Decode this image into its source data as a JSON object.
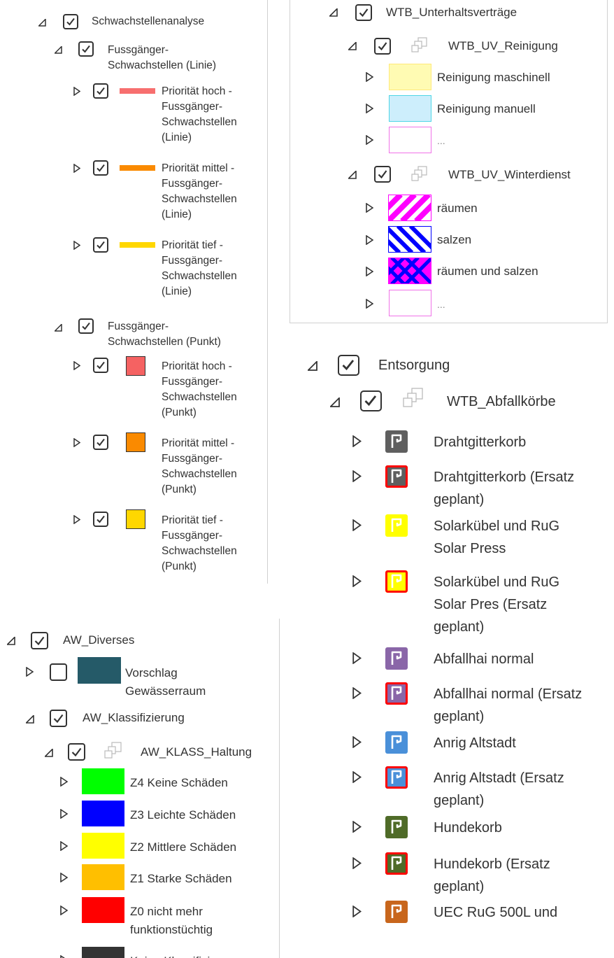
{
  "colors": {
    "text": "#333333",
    "divider": "#d0d0d0",
    "line_hoch": "#f76f6f",
    "line_mittel": "#fa8a00",
    "line_tief": "#ffd700",
    "pt_hoch": "#f56262",
    "pt_mittel": "#fa8a00",
    "pt_tief": "#ffd700",
    "vorschlag": "#255a68",
    "reinigung_maschinell": "#fffbb3",
    "reinigung_manuell": "#cdeefc",
    "z4": "#00ff00",
    "z3": "#0000ff",
    "z2": "#ffff00",
    "z1": "#ffbf00",
    "z0": "#ff0000",
    "keine": "#333333",
    "drahtgitter": "#5f5f5f",
    "solar": "#ffff00",
    "abfallhai": "#8a66a8",
    "anrig": "#4a90d9",
    "hunde": "#4f6b28",
    "uec": "#c8661c",
    "ersatz_border": "#ff0000"
  },
  "schwachstellen": {
    "title": "Schwachstellenanalyse",
    "linie": {
      "title_lines": [
        "Fussgänger-",
        "Schwachstellen (Linie)"
      ],
      "items": [
        {
          "lines": [
            "Priorität hoch -",
            "Fussgänger-",
            "Schwachstellen",
            "(Linie)"
          ]
        },
        {
          "lines": [
            "Priorität mittel -",
            "Fussgänger-",
            "Schwachstellen",
            "(Linie)"
          ]
        },
        {
          "lines": [
            "Priorität tief -",
            "Fussgänger-",
            "Schwachstellen",
            "(Linie)"
          ]
        }
      ]
    },
    "punkt": {
      "title_lines": [
        "Fussgänger-",
        "Schwachstellen (Punkt)"
      ],
      "items": [
        {
          "lines": [
            "Priorität hoch -",
            "Fussgänger-",
            "Schwachstellen",
            "(Punkt)"
          ]
        },
        {
          "lines": [
            "Priorität mittel -",
            "Fussgänger-",
            "Schwachstellen",
            "(Punkt)"
          ]
        },
        {
          "lines": [
            "Priorität tief -",
            "Fussgänger-",
            "Schwachstellen",
            "(Punkt)"
          ]
        }
      ]
    }
  },
  "unterhalt": {
    "title": "WTB_Unterhaltsverträge",
    "reinigung": {
      "title": "WTB_UV_Reinigung",
      "items": [
        "Reinigung maschinell",
        "Reinigung manuell",
        "..."
      ]
    },
    "winterdienst": {
      "title": "WTB_UV_Winterdienst",
      "items": [
        "räumen",
        "salzen",
        "räumen und salzen",
        "..."
      ]
    }
  },
  "entsorgung": {
    "title": "Entsorgung",
    "abfallkoerbe": {
      "title": "WTB_Abfallkörbe",
      "items": [
        {
          "lines": [
            "Drahtgitterkorb"
          ]
        },
        {
          "lines": [
            "Drahtgitterkorb (Ersatz",
            "geplant)"
          ]
        },
        {
          "lines": [
            "Solarkübel und RuG",
            "Solar Press"
          ]
        },
        {
          "lines": [
            "Solarkübel und RuG",
            "Solar Pres (Ersatz",
            "geplant)"
          ]
        },
        {
          "lines": [
            "Abfallhai normal"
          ]
        },
        {
          "lines": [
            "Abfallhai normal (Ersatz",
            "geplant)"
          ]
        },
        {
          "lines": [
            "Anrig Altstadt"
          ]
        },
        {
          "lines": [
            "Anrig Altstadt (Ersatz",
            "geplant)"
          ]
        },
        {
          "lines": [
            "Hundekorb"
          ]
        },
        {
          "lines": [
            "Hundekorb (Ersatz",
            "geplant)"
          ]
        },
        {
          "lines": [
            "UEC RuG 500L und"
          ]
        }
      ]
    }
  },
  "aw": {
    "title": "AW_Diverses",
    "vorschlag_lines": [
      "Vorschlag",
      "Gewässerraum"
    ],
    "klassifizierung": {
      "title": "AW_Klassifizierung",
      "haltung": {
        "title": "AW_KLASS_Haltung",
        "items": [
          "Z4 Keine Schäden",
          "Z3 Leichte Schäden",
          "Z2 Mittlere Schäden",
          "Z1 Starke Schäden",
          "Z0 nicht mehr",
          "funktionstüchtig",
          "Keine Klassifizierung"
        ]
      }
    }
  }
}
